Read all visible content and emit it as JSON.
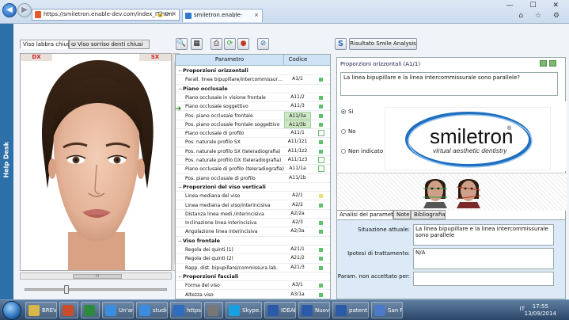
{
  "browser": {
    "url": "https://smiletron.enable-dev.com/index_IT.html",
    "tab_title": "smiletron.enable-dev.com",
    "tab_close": "×",
    "addr_tools": "🔒 ⟳ ✕",
    "window_buttons": "— ☐ ✕",
    "toolbar_icons": "⌂ ☆ ⚙"
  },
  "helpdesk": {
    "label": "Help Desk"
  },
  "left": {
    "tabs": [
      "Viso labbra chiuse",
      "Viso sorriso denti chiusi"
    ],
    "dx_label": "DX",
    "sx_label": "SX",
    "hscroll_grip": "III",
    "slider_value": 0.28
  },
  "grid": {
    "col_param": "Parametro",
    "col_code": "Codice",
    "rows": [
      {
        "type": "group",
        "label": "Proporzioni orizzontali"
      },
      {
        "type": "item",
        "label": "Parall. linea bipupillare/intercommissurale",
        "code": "A1/1",
        "mark": "g"
      },
      {
        "type": "group",
        "label": "Piano occlusale"
      },
      {
        "type": "item",
        "label": "Piano occlusale in visione frontale",
        "code": "A11/2",
        "mark": "g"
      },
      {
        "type": "item",
        "label": "Piano occlusale soggettivo",
        "code": "A11/3",
        "mark": "g"
      },
      {
        "type": "item",
        "label": "Pos. piano occlusale frontale",
        "code": "A11/3a",
        "mark": "g",
        "hl": true
      },
      {
        "type": "item",
        "label": "Pos. piano occlusale frontale soggettivo",
        "code": "A11/3b",
        "mark": "g",
        "hl": true
      },
      {
        "type": "item",
        "label": "Piano occlusale di profilo",
        "code": "A11/1",
        "mark": "box"
      },
      {
        "type": "item",
        "label": "Pos. naturale profilo SX",
        "code": "A11/1z1",
        "mark": "g"
      },
      {
        "type": "item",
        "label": "Pos. naturale profilo SX (teleradiografia)",
        "code": "A11/1z2",
        "mark": "g"
      },
      {
        "type": "item",
        "label": "Pos. naturale profilo DX (teleradiografia)",
        "code": "A11/1z3",
        "mark": "box"
      },
      {
        "type": "item",
        "label": "Piano occlusale di profilo (teleradiografia)",
        "code": "A11/1a",
        "mark": "box"
      },
      {
        "type": "item",
        "label": "Pos. piano occlusale di profilo",
        "code": "A11/1b",
        "mark": ""
      },
      {
        "type": "group",
        "label": "Proporzioni del viso verticali"
      },
      {
        "type": "item",
        "label": "Linea mediana del viso",
        "code": "A2/1",
        "mark": "y"
      },
      {
        "type": "item",
        "label": "Linea mediana del viso/interincisiva",
        "code": "A2/2",
        "mark": "g"
      },
      {
        "type": "item",
        "label": "Distanza linea medi./interincisiva",
        "code": "A2/2a",
        "mark": ""
      },
      {
        "type": "item",
        "label": "Inclinazione linea interincisiva",
        "code": "A2/3",
        "mark": "g"
      },
      {
        "type": "item",
        "label": "Angolazione linea interincisiva",
        "code": "A2/3a",
        "mark": "g"
      },
      {
        "type": "group",
        "label": "Viso frontale"
      },
      {
        "type": "item",
        "label": "Regola dei quinti (1)",
        "code": "A21/1",
        "mark": "g"
      },
      {
        "type": "item",
        "label": "Regola dei quinti (2)",
        "code": "A21/2",
        "mark": "g"
      },
      {
        "type": "item",
        "label": "Rapp. dist. bipupillare/commissura lab.",
        "code": "A21/3",
        "mark": "g"
      },
      {
        "type": "group",
        "label": "Proporzioni facciali"
      },
      {
        "type": "item",
        "label": "Forma del viso",
        "code": "A3/1",
        "mark": "g"
      },
      {
        "type": "item",
        "label": "Altezza viso",
        "code": "A3/1a",
        "mark": "g"
      }
    ]
  },
  "right": {
    "result_button": "Risultato Smile Analysis",
    "question_title": "Proporzioni orizzontali (A1/1)",
    "question_text": "La linea bipupillare e la linea intercommissurale sono parallele?",
    "options": [
      "Si",
      "No",
      "Non indicato"
    ],
    "selected_option": 0,
    "logo_name": "smiletron",
    "logo_reg": "®",
    "logo_tagline": "virtual aesthetic dentistry",
    "bottom_tabs": [
      "Analisi del parametro",
      "Note",
      "Bibliografia"
    ],
    "fields": [
      {
        "label": "Situazione attuale:",
        "value": "La linea bipupillare e la linea intercommissurale sono parallele"
      },
      {
        "label": "Ipotesi di trattamento:",
        "value": "N/A"
      },
      {
        "label": "Param. non accettato per:",
        "value": ""
      }
    ]
  },
  "taskbar": {
    "items": [
      {
        "label": "BREVE...",
        "color": "#d8b64a"
      },
      {
        "label": "",
        "color": "#c84d2a"
      },
      {
        "label": "",
        "color": "#2d8a3e"
      },
      {
        "label": "Un'art...",
        "color": "#3b8de0"
      },
      {
        "label": "studio...",
        "color": "#3b8de0"
      },
      {
        "label": "https:...",
        "color": "#2f6bbf"
      },
      {
        "label": "",
        "color": "#777"
      },
      {
        "label": "Skype...",
        "color": "#1aa0e0"
      },
      {
        "label": "IDEAL ...",
        "color": "#2a5aa8"
      },
      {
        "label": "Nuov...",
        "color": "#2a5aa8"
      },
      {
        "label": "patent...",
        "color": "#2a5aa8"
      },
      {
        "label": "San R...",
        "color": "#4a7ac8"
      }
    ],
    "lang": "IT",
    "time": "17:55",
    "date": "13/09/2014"
  }
}
